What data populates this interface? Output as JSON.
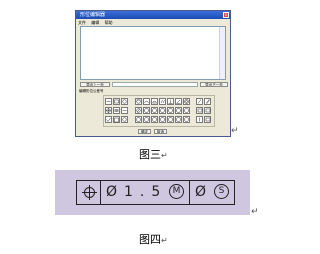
{
  "figure3": {
    "caption": "图三",
    "dialog": {
      "title": "形位编辑器",
      "close_glyph": "×",
      "menu": [
        "文件",
        "编辑",
        "帮助"
      ],
      "prev_button": "导出上一页",
      "next_button": "导出下一页",
      "symbols_group_label": "编辑形位公差号",
      "ok_button": "确定",
      "cancel_button": "取消"
    }
  },
  "figure4": {
    "caption": "图四",
    "frame": {
      "cell1_icon": "position-symbol-icon",
      "cell2_text": "Ø1.5",
      "cell2_modifier": "M",
      "cell3_text": "Ø",
      "cell3_modifier": "S"
    }
  },
  "paragraph_mark": "↵"
}
